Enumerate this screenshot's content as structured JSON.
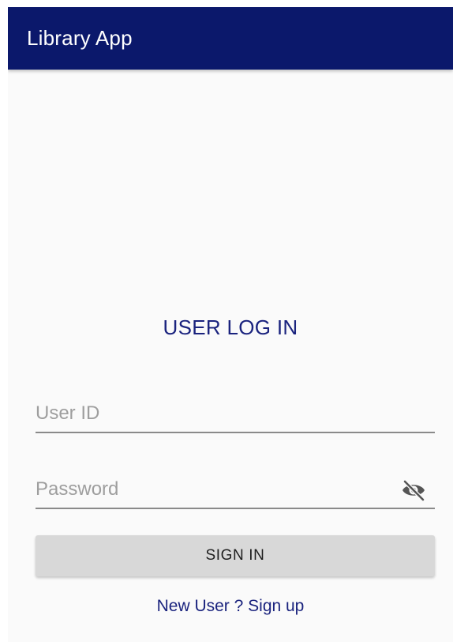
{
  "app_bar": {
    "title": "Library App"
  },
  "login": {
    "heading": "USER LOG IN",
    "user_id": {
      "value": "",
      "placeholder": "User ID"
    },
    "password": {
      "value": "",
      "placeholder": "Password",
      "toggle_icon": "eye-off-icon"
    },
    "sign_in_label": "SIGN IN",
    "signup_link": "New User ? Sign up"
  },
  "colors": {
    "app_bar": "#0b186b",
    "accent_text": "#1a237e",
    "button_bg": "#d8d8d8",
    "background": "#fafafa"
  }
}
